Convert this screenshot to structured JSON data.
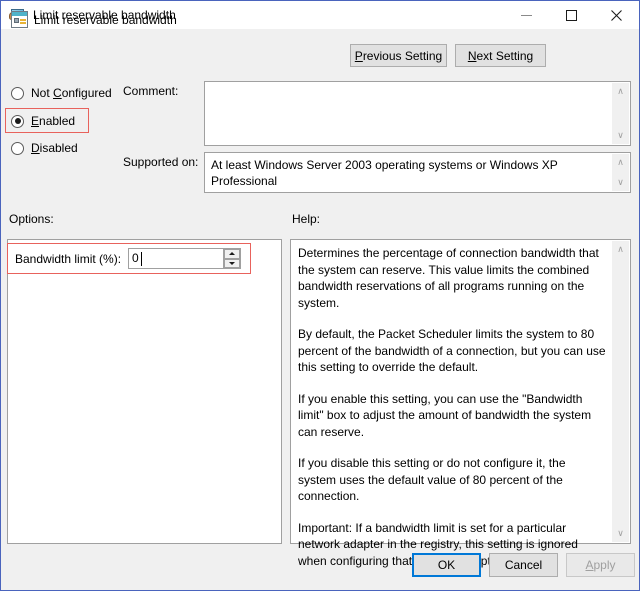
{
  "window": {
    "title": "Limit reservable bandwidth",
    "icon": "computer-user-icon",
    "minimize_label": "–",
    "maximize_label": "□",
    "close_label": "✕"
  },
  "header": {
    "setting_title": "Limit reservable bandwidth",
    "icon": "policy-setting-icon",
    "previous_button": {
      "pre": "",
      "accel": "P",
      "post": "revious Setting"
    },
    "next_button": {
      "pre": "",
      "accel": "N",
      "post": "ext Setting"
    }
  },
  "state": {
    "options": [
      {
        "id": "not-configured",
        "pre": "Not ",
        "accel": "C",
        "post": "onfigured",
        "selected": false
      },
      {
        "id": "enabled",
        "pre": "",
        "accel": "E",
        "post": "nabled",
        "selected": true
      },
      {
        "id": "disabled",
        "pre": "",
        "accel": "D",
        "post": "isabled",
        "selected": false
      }
    ]
  },
  "comment": {
    "label": "Comment:",
    "value": ""
  },
  "supported": {
    "label": "Supported on:",
    "value": "At least Windows Server 2003 operating systems or Windows XP Professional"
  },
  "options_panel": {
    "label": "Options:",
    "bandwidth_label": "Bandwidth limit (%):",
    "bandwidth_value": "0"
  },
  "help_panel": {
    "label": "Help:",
    "paragraphs": [
      "Determines the percentage of connection bandwidth that the system can reserve. This value limits the combined bandwidth reservations of all programs running on the system.",
      "By default, the Packet Scheduler limits the system to 80 percent of the bandwidth of a connection, but you can use this setting to override the default.",
      "If you enable this setting, you can use the \"Bandwidth limit\" box to adjust the amount of bandwidth the system can reserve.",
      "If you disable this setting or do not configure it, the system uses the default value of 80 percent of the connection.",
      "Important: If a bandwidth limit is set for a particular network adapter in the registry, this setting is ignored when configuring that network adapter."
    ]
  },
  "footer": {
    "ok_label": "OK",
    "cancel_label": "Cancel",
    "apply": {
      "pre": "",
      "accel": "A",
      "post": "pply"
    }
  },
  "colors": {
    "window_border": "#4a64bd",
    "dialog_background": "#f0f0f0",
    "highlight_red": "#e8625c",
    "focus_blue": "#0078d7"
  },
  "scroll": {
    "up_glyph": "∧",
    "down_glyph": "∨"
  }
}
